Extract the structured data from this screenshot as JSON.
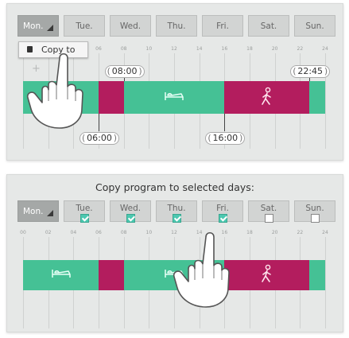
{
  "hours": [
    "00",
    "02",
    "04",
    "06",
    "08",
    "10",
    "12",
    "14",
    "16",
    "18",
    "20",
    "22",
    "24"
  ],
  "panel1": {
    "tabs": [
      {
        "label": "Mon.",
        "active": true
      },
      {
        "label": "Tue."
      },
      {
        "label": "Wed."
      },
      {
        "label": "Thu."
      },
      {
        "label": "Fri."
      },
      {
        "label": "Sat."
      },
      {
        "label": "Sun."
      }
    ],
    "popup_label": "Copy to",
    "plus_label": "+",
    "segments": [
      {
        "mode": "comfort",
        "from_h": 0,
        "to_h": 6,
        "icon": "bed-icon"
      },
      {
        "mode": "away",
        "from_h": 6,
        "to_h": 8
      },
      {
        "mode": "comfort",
        "from_h": 8,
        "to_h": 16,
        "icon": "bed-icon"
      },
      {
        "mode": "away",
        "from_h": 16,
        "to_h": 22.75,
        "icon": "walking-person-icon"
      },
      {
        "mode": "comfort",
        "from_h": 22.75,
        "to_h": 24
      }
    ],
    "times_top": [
      {
        "label": "08:00",
        "h": 8
      },
      {
        "label": "22:45",
        "h": 22.75
      }
    ],
    "times_bottom": [
      {
        "label": "06:00",
        "h": 6
      },
      {
        "label": "16:00",
        "h": 16
      }
    ]
  },
  "panel2": {
    "caption": "Copy program to selected days:",
    "tabs": [
      {
        "label": "Mon.",
        "active": true
      },
      {
        "label": "Tue.",
        "checked": true
      },
      {
        "label": "Wed.",
        "checked": true
      },
      {
        "label": "Thu.",
        "checked": true
      },
      {
        "label": "Fri.",
        "checked": true
      },
      {
        "label": "Sat.",
        "checked": false
      },
      {
        "label": "Sun.",
        "checked": false
      }
    ],
    "segments": [
      {
        "mode": "comfort",
        "from_h": 0,
        "to_h": 6,
        "icon": "bed-icon"
      },
      {
        "mode": "away",
        "from_h": 6,
        "to_h": 8
      },
      {
        "mode": "comfort",
        "from_h": 8,
        "to_h": 16,
        "icon": "bed-icon"
      },
      {
        "mode": "away",
        "from_h": 16,
        "to_h": 22.75,
        "icon": "walking-person-icon"
      },
      {
        "mode": "comfort",
        "from_h": 22.75,
        "to_h": 24
      }
    ]
  },
  "colors": {
    "comfort": "#45c195",
    "away": "#b31d5e",
    "checkbox_on": "#4cc8b0"
  },
  "icons": {
    "pointer": "hand-pointer-icon",
    "popup": "copy-icon",
    "menu": "triangle-dropdown-icon"
  }
}
